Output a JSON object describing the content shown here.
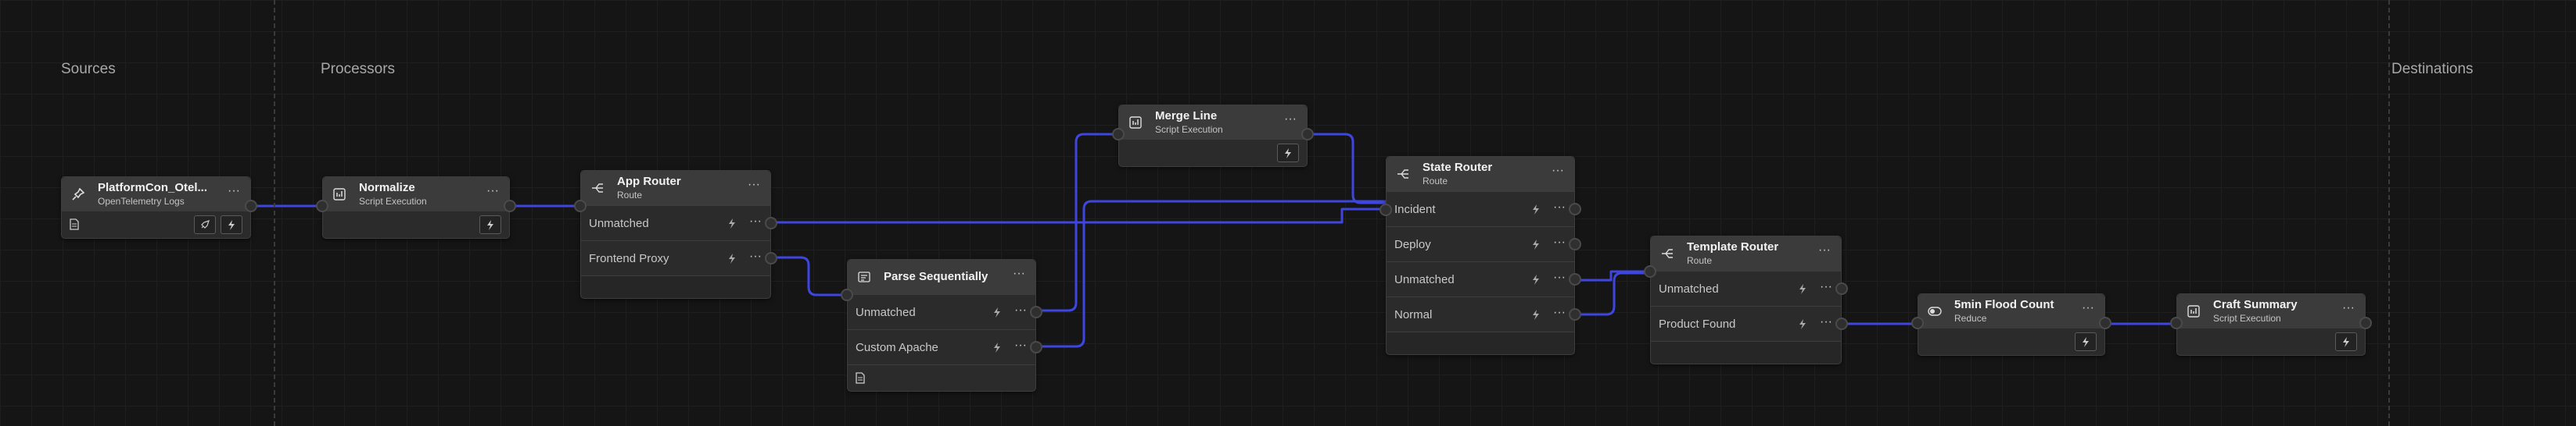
{
  "sections": {
    "sources": "Sources",
    "processors": "Processors",
    "destinations": "Destinations"
  },
  "colors": {
    "wire": "#3f46e0",
    "background": "#151515",
    "node": "#2b2b2b",
    "node_header": "#3b3b3b"
  },
  "nodes": {
    "platformcon": {
      "title": "PlatformCon_Otel...",
      "subtitle": "OpenTelemetry Logs",
      "icon": "pin-icon"
    },
    "normalize": {
      "title": "Normalize",
      "subtitle": "Script Execution",
      "icon": "script-icon"
    },
    "app_router": {
      "title": "App Router",
      "subtitle": "Route",
      "icon": "route-icon",
      "routes": [
        "Unmatched",
        "Frontend Proxy"
      ]
    },
    "parse_sequentially": {
      "title": "Parse Sequentially",
      "subtitle": "",
      "icon": "parse-icon",
      "routes": [
        "Unmatched",
        "Custom Apache"
      ]
    },
    "merge_line": {
      "title": "Merge Line",
      "subtitle": "Script Execution",
      "icon": "script-icon"
    },
    "state_router": {
      "title": "State Router",
      "subtitle": "Route",
      "icon": "route-icon",
      "routes": [
        "Incident",
        "Deploy",
        "Unmatched",
        "Normal"
      ]
    },
    "template_router": {
      "title": "Template Router",
      "subtitle": "Route",
      "icon": "route-icon",
      "routes": [
        "Unmatched",
        "Product Found"
      ]
    },
    "flood_count": {
      "title": "5min Flood Count",
      "subtitle": "Reduce",
      "icon": "toggle-icon"
    },
    "craft_summary": {
      "title": "Craft Summary",
      "subtitle": "Script Execution",
      "icon": "script-icon"
    }
  },
  "menu_glyph": "···"
}
